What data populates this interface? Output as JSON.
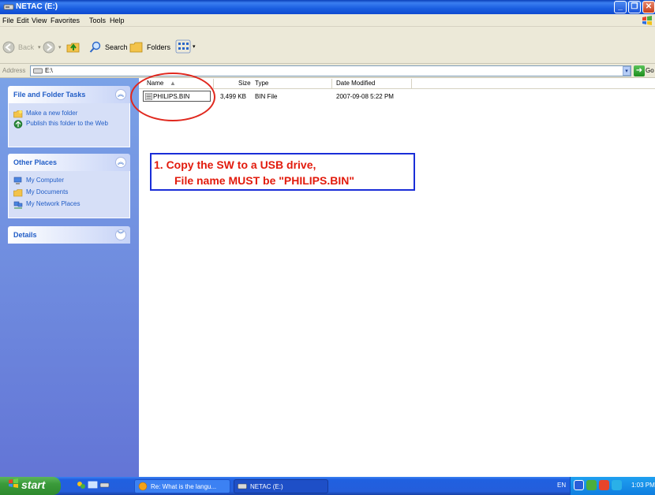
{
  "window": {
    "title": "NETAC (E:)",
    "buttons": {
      "minimize": "_",
      "maximize": "❐",
      "close": "✕"
    }
  },
  "menu": [
    "File",
    "Edit",
    "View",
    "Favorites",
    "Tools",
    "Help"
  ],
  "toolbar": {
    "back": "Back",
    "search": "Search",
    "folders": "Folders"
  },
  "address": {
    "label": "Address",
    "value": "E:\\",
    "go": "Go"
  },
  "tasks": {
    "file_folder": {
      "title": "File and Folder Tasks",
      "items": [
        "Make a new folder",
        "Publish this folder to the Web"
      ]
    },
    "other_places": {
      "title": "Other Places",
      "items": [
        "My Computer",
        "My Documents",
        "My Network Places"
      ]
    },
    "details": {
      "title": "Details"
    }
  },
  "file_list": {
    "columns": [
      "Name",
      "Size",
      "Type",
      "Date Modified"
    ],
    "rows": [
      {
        "name": "PHILIPS.BIN",
        "size": "3,499 KB",
        "type": "BIN File",
        "modified": "2007-09-08 5:22 PM"
      }
    ]
  },
  "annotation": {
    "line1": "1.  Copy the SW to a USB drive,",
    "line2": "File name MUST be \"PHILIPS.BIN\""
  },
  "taskbar": {
    "start": "start",
    "buttons": [
      "Re: What is the langu...",
      "NETAC (E:)"
    ],
    "language": "EN",
    "clock": "1:03 PM"
  }
}
